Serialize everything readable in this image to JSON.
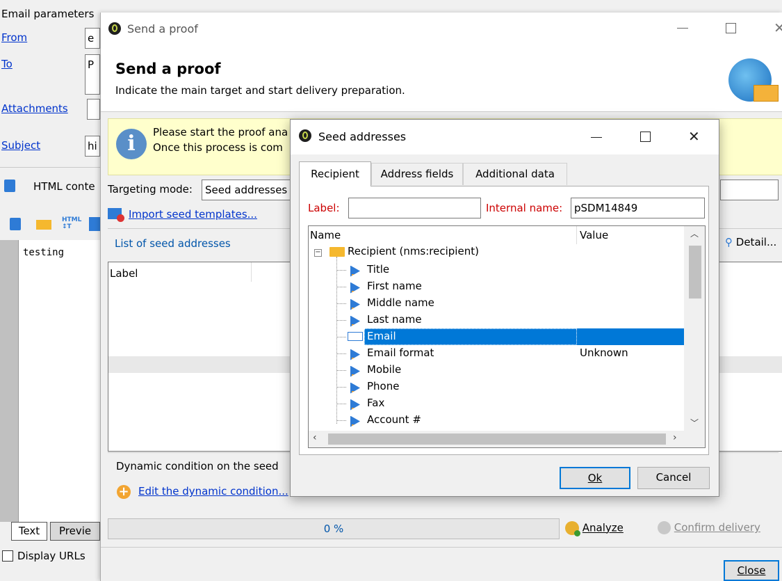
{
  "bg": {
    "email_params_title": "Email parameters",
    "from_label": "From",
    "from_value": "e",
    "to_label": "To",
    "to_value": "P",
    "attachments_label": "Attachments",
    "subject_label": "Subject",
    "subject_value": "hi",
    "html_content_label": "HTML conte",
    "editor_text": "testing",
    "tab_text": "Text",
    "tab_preview": "Previe",
    "display_urls": "Display URLs"
  },
  "proof": {
    "window_title": "Send a proof",
    "heading": "Send a proof",
    "subheading": "Indicate the main target and start delivery preparation.",
    "info_line1": "Please start the proof ana",
    "info_line2": "Once this process is com",
    "targeting_label": "Targeting mode:",
    "targeting_value": "Seed addresses",
    "import_link": "Import seed templates...",
    "list_title": "List of seed addresses",
    "details_label": "Detail...",
    "list_col_label": "Label",
    "dynamic_condition": "Dynamic condition on the seed",
    "edit_condition_link": "Edit the dynamic condition...",
    "progress_text": "0 %",
    "progress": 0,
    "analyze_label": "Analyze",
    "confirm_label": "Confirm delivery",
    "close_label": "Close"
  },
  "seed": {
    "window_title": "Seed addresses",
    "tabs": [
      "Recipient",
      "Address fields",
      "Additional data"
    ],
    "label_caption": "Label:",
    "label_value": "",
    "internal_name_caption": "Internal name:",
    "internal_name_value": "pSDM14849",
    "col_name": "Name",
    "col_value": "Value",
    "root_node": "Recipient (nms:recipient)",
    "fields": [
      {
        "name": "Title",
        "value": ""
      },
      {
        "name": "First name",
        "value": ""
      },
      {
        "name": "Middle name",
        "value": ""
      },
      {
        "name": "Last name",
        "value": ""
      },
      {
        "name": "Email",
        "value": ""
      },
      {
        "name": "Email format",
        "value": "Unknown"
      },
      {
        "name": "Mobile",
        "value": ""
      },
      {
        "name": "Phone",
        "value": ""
      },
      {
        "name": "Fax",
        "value": ""
      },
      {
        "name": "Account #",
        "value": ""
      }
    ],
    "selected_field": "Email",
    "ok_label": "Ok",
    "cancel_label": "Cancel"
  },
  "colors": {
    "selection": "#0078d7",
    "info_bg": "#ffffcc",
    "link": "#0033cc",
    "required_label": "#cc0000"
  }
}
